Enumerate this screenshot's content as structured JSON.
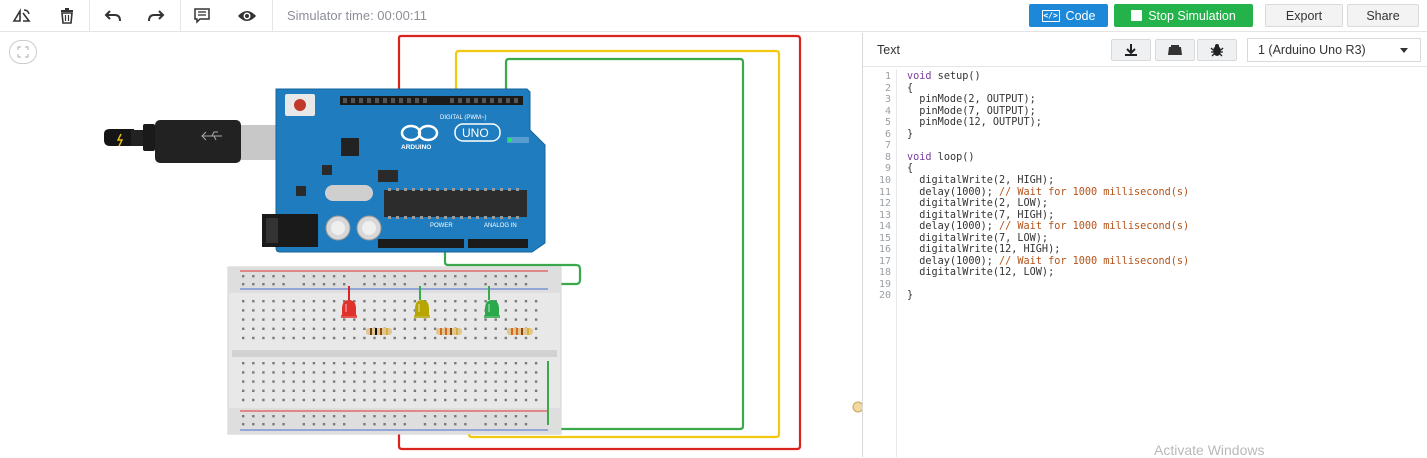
{
  "toolbar": {
    "icons": [
      "rotate-icon",
      "delete-icon",
      "undo-icon",
      "redo-icon",
      "notes-icon",
      "visibility-icon"
    ],
    "simulator_time": "Simulator time: 00:00:11",
    "code_label": "Code",
    "stop_label": "Stop Simulation",
    "export_label": "Export",
    "share_label": "Share"
  },
  "board": {
    "label": "UNO",
    "brand": "ARDUINO",
    "digital_header": "DIGITAL (PWM~)",
    "analog_header": "ANALOG IN",
    "power_header": "POWER"
  },
  "leds": [
    {
      "color": "red",
      "hex": "#e0312b"
    },
    {
      "color": "yellow",
      "hex": "#b7a500"
    },
    {
      "color": "green",
      "hex": "#2aa94a"
    }
  ],
  "wires": {
    "red": "#d8231f",
    "yellow": "#f2c811",
    "green": "#3aa84b"
  },
  "code_panel": {
    "mode": "Text",
    "device": "1 (Arduino Uno R3)",
    "header_icons": [
      "download-icon",
      "library-icon",
      "debug-icon"
    ],
    "lines": [
      {
        "n": "1",
        "kw": "void",
        "rest": " setup()",
        "cmt": ""
      },
      {
        "n": "2",
        "kw": "",
        "rest": "{",
        "cmt": ""
      },
      {
        "n": "3",
        "kw": "",
        "rest": "  pinMode(2, OUTPUT);",
        "cmt": ""
      },
      {
        "n": "4",
        "kw": "",
        "rest": "  pinMode(7, OUTPUT);",
        "cmt": ""
      },
      {
        "n": "5",
        "kw": "",
        "rest": "  pinMode(12, OUTPUT);",
        "cmt": ""
      },
      {
        "n": "6",
        "kw": "",
        "rest": "}",
        "cmt": ""
      },
      {
        "n": "7",
        "kw": "",
        "rest": "",
        "cmt": ""
      },
      {
        "n": "8",
        "kw": "void",
        "rest": " loop()",
        "cmt": ""
      },
      {
        "n": "9",
        "kw": "",
        "rest": "{",
        "cmt": ""
      },
      {
        "n": "10",
        "kw": "",
        "rest": "  digitalWrite(2, HIGH);",
        "cmt": ""
      },
      {
        "n": "11",
        "kw": "",
        "rest": "  delay(1000); ",
        "cmt": "// Wait for 1000 millisecond(s)"
      },
      {
        "n": "12",
        "kw": "",
        "rest": "  digitalWrite(2, LOW);",
        "cmt": ""
      },
      {
        "n": "13",
        "kw": "",
        "rest": "  digitalWrite(7, HIGH);",
        "cmt": ""
      },
      {
        "n": "14",
        "kw": "",
        "rest": "  delay(1000); ",
        "cmt": "// Wait for 1000 millisecond(s)"
      },
      {
        "n": "15",
        "kw": "",
        "rest": "  digitalWrite(7, LOW);",
        "cmt": ""
      },
      {
        "n": "16",
        "kw": "",
        "rest": "  digitalWrite(12, HIGH);",
        "cmt": ""
      },
      {
        "n": "17",
        "kw": "",
        "rest": "  delay(1000); ",
        "cmt": "// Wait for 1000 millisecond(s)"
      },
      {
        "n": "18",
        "kw": "",
        "rest": "  digitalWrite(12, LOW);",
        "cmt": ""
      },
      {
        "n": "19",
        "kw": "",
        "rest": "",
        "cmt": ""
      },
      {
        "n": "20",
        "kw": "",
        "rest": "}",
        "cmt": ""
      }
    ]
  },
  "watermark": "Activate Windows"
}
